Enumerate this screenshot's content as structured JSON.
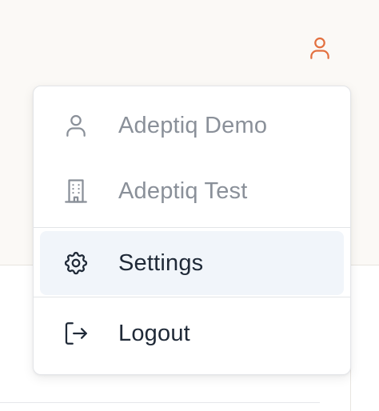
{
  "header": {
    "user_icon": "user-icon",
    "accent_color": "#e3703f"
  },
  "menu": {
    "items": [
      {
        "label": "Adeptiq Demo",
        "icon": "user-icon",
        "state": "disabled"
      },
      {
        "label": "Adeptiq Test",
        "icon": "building-icon",
        "state": "disabled"
      },
      {
        "label": "Settings",
        "icon": "gear-icon",
        "state": "hover"
      },
      {
        "label": "Logout",
        "icon": "logout-icon",
        "state": "normal"
      }
    ]
  }
}
